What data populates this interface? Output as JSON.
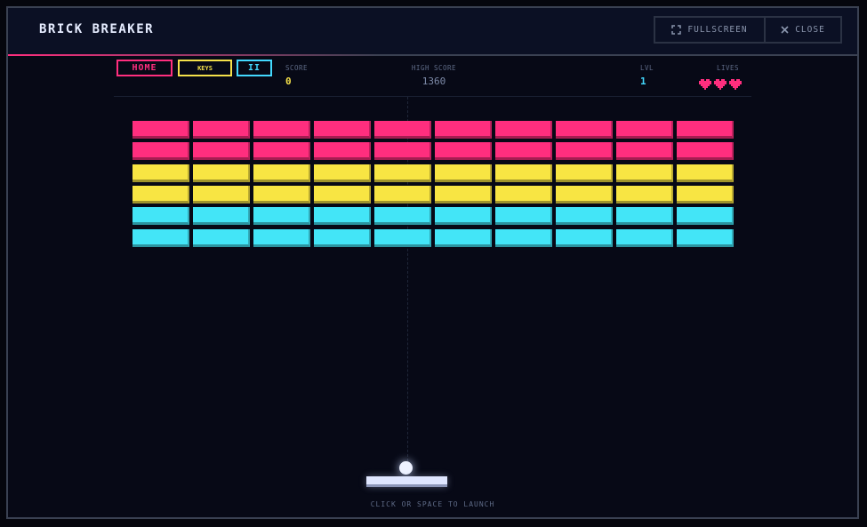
{
  "window": {
    "title": "BRICK BREAKER",
    "fullscreen_label": "FULLSCREEN",
    "close_label": "CLOSE"
  },
  "hud": {
    "home_label": "HOME",
    "keys_label": "KEYS",
    "pause_label": "II",
    "score_label": "SCORE",
    "score_value": "0",
    "high_score_label": "HIGH SCORE",
    "high_score_value": "1360",
    "level_label": "LVL",
    "level_value": "1",
    "lives_label": "LIVES",
    "lives_count": 3
  },
  "bricks": {
    "columns": 10,
    "rows": [
      {
        "color": "#ff2e7e"
      },
      {
        "color": "#ff2e7e"
      },
      {
        "color": "#f8e543"
      },
      {
        "color": "#f8e543"
      },
      {
        "color": "#43e5f7"
      },
      {
        "color": "#43e5f7"
      }
    ]
  },
  "hint": "CLICK OR SPACE TO LAUNCH",
  "colors": {
    "pink": "#ff2e7e",
    "yellow": "#f5e14a",
    "cyan": "#43d9ff",
    "background": "#070916"
  }
}
